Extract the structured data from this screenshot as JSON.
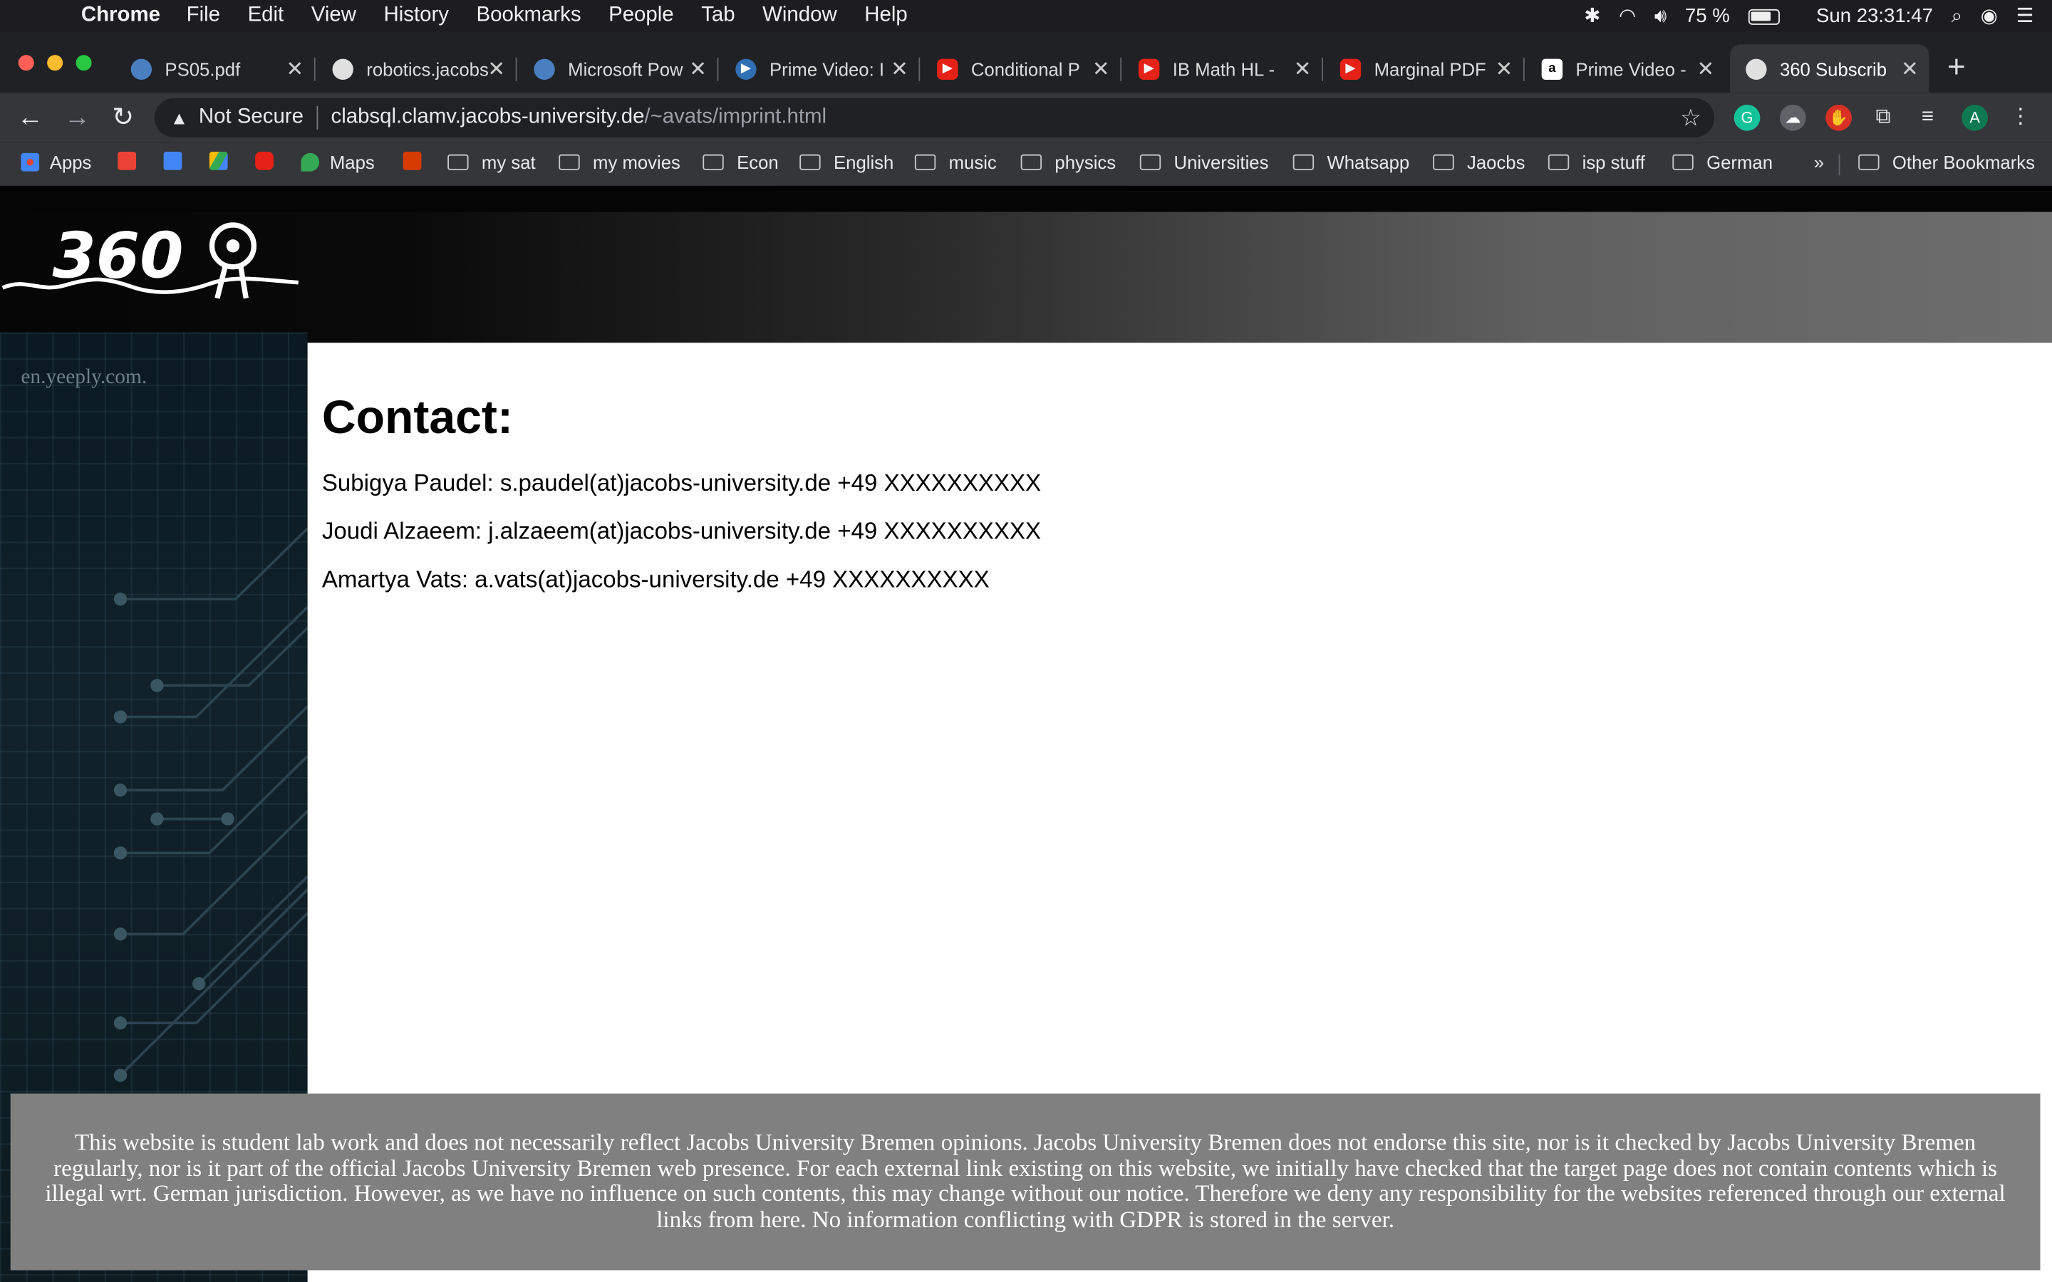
{
  "menubar": {
    "app_name": "Chrome",
    "items": [
      "File",
      "Edit",
      "View",
      "History",
      "Bookmarks",
      "People",
      "Tab",
      "Window",
      "Help"
    ],
    "battery": "75 %",
    "clock": "Sun 23:31:47"
  },
  "tabs": [
    {
      "title": "PS05.pdf",
      "icon": "drive-icon"
    },
    {
      "title": "robotics.jacobs",
      "icon": "globe-icon"
    },
    {
      "title": "Microsoft Pow",
      "icon": "drive-icon"
    },
    {
      "title": "Prime Video: I",
      "icon": "prime-icon"
    },
    {
      "title": "Conditional P",
      "icon": "youtube-icon"
    },
    {
      "title": "IB Math HL - ",
      "icon": "youtube-icon"
    },
    {
      "title": "Marginal PDF",
      "icon": "youtube-icon"
    },
    {
      "title": "Prime Video - ",
      "icon": "amazon-icon"
    },
    {
      "title": "360 Subscrib",
      "icon": "globe-icon",
      "active": true
    }
  ],
  "omnibox": {
    "security_label": "Not Secure",
    "host": "clabsql.clamv.jacobs-university.de",
    "path": "/~avats/imprint.html"
  },
  "bookmarks": {
    "apps": "Apps",
    "maps": "Maps",
    "folders": [
      "my sat",
      "my movies",
      "Econ",
      "English",
      "music",
      "physics",
      "Universities",
      "Whatsapp",
      "Jaocbs",
      "isp stuff",
      "German"
    ],
    "overflow": "»",
    "other": "Other Bookmarks"
  },
  "profile_initial": "A",
  "page": {
    "logo_text": "360",
    "sidebar_text": "en.yeeply.com.",
    "heading": "Contact:",
    "contacts": [
      "Subigya Paudel: s.paudel(at)jacobs-university.de +49 XXXXXXXXXX",
      "Joudi Alzaeem: j.alzaeem(at)jacobs-university.de +49 XXXXXXXXXX",
      "Amartya Vats: a.vats(at)jacobs-university.de +49 XXXXXXXXXX"
    ],
    "disclaimer": "This website is student lab work and does not necessarily reflect Jacobs University Bremen opinions. Jacobs University Bremen does not endorse this site, nor is it checked by Jacobs University Bremen regularly, nor is it part of the official Jacobs University Bremen web presence. For each external link existing on this website, we initially have checked that the target page does not contain contents which is illegal wrt. German jurisdiction. However, as we have no influence on such contents, this may change without our notice. Therefore we deny any responsibility for the websites referenced through our external links from here. No information conflicting with GDPR is stored in the server."
  },
  "colors": {
    "menubar_bg": "#1d1d1f",
    "tabstrip_bg": "#202124",
    "toolbar_bg": "#35363a",
    "footer_bg": "#808080",
    "close_red": "#ff5f57",
    "minimize_yellow": "#febc2e",
    "zoom_green": "#28c840"
  }
}
